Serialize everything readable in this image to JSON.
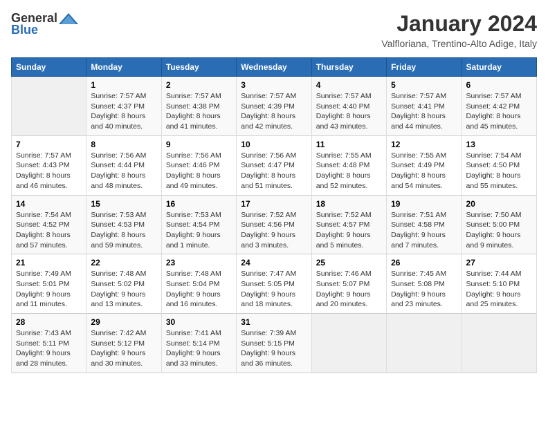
{
  "header": {
    "logo_general": "General",
    "logo_blue": "Blue",
    "month_year": "January 2024",
    "location": "Valfloriana, Trentino-Alto Adige, Italy"
  },
  "days_of_week": [
    "Sunday",
    "Monday",
    "Tuesday",
    "Wednesday",
    "Thursday",
    "Friday",
    "Saturday"
  ],
  "weeks": [
    [
      {
        "day": "",
        "content": ""
      },
      {
        "day": "1",
        "content": "Sunrise: 7:57 AM\nSunset: 4:37 PM\nDaylight: 8 hours\nand 40 minutes."
      },
      {
        "day": "2",
        "content": "Sunrise: 7:57 AM\nSunset: 4:38 PM\nDaylight: 8 hours\nand 41 minutes."
      },
      {
        "day": "3",
        "content": "Sunrise: 7:57 AM\nSunset: 4:39 PM\nDaylight: 8 hours\nand 42 minutes."
      },
      {
        "day": "4",
        "content": "Sunrise: 7:57 AM\nSunset: 4:40 PM\nDaylight: 8 hours\nand 43 minutes."
      },
      {
        "day": "5",
        "content": "Sunrise: 7:57 AM\nSunset: 4:41 PM\nDaylight: 8 hours\nand 44 minutes."
      },
      {
        "day": "6",
        "content": "Sunrise: 7:57 AM\nSunset: 4:42 PM\nDaylight: 8 hours\nand 45 minutes."
      }
    ],
    [
      {
        "day": "7",
        "content": "Sunrise: 7:57 AM\nSunset: 4:43 PM\nDaylight: 8 hours\nand 46 minutes."
      },
      {
        "day": "8",
        "content": "Sunrise: 7:56 AM\nSunset: 4:44 PM\nDaylight: 8 hours\nand 48 minutes."
      },
      {
        "day": "9",
        "content": "Sunrise: 7:56 AM\nSunset: 4:46 PM\nDaylight: 8 hours\nand 49 minutes."
      },
      {
        "day": "10",
        "content": "Sunrise: 7:56 AM\nSunset: 4:47 PM\nDaylight: 8 hours\nand 51 minutes."
      },
      {
        "day": "11",
        "content": "Sunrise: 7:55 AM\nSunset: 4:48 PM\nDaylight: 8 hours\nand 52 minutes."
      },
      {
        "day": "12",
        "content": "Sunrise: 7:55 AM\nSunset: 4:49 PM\nDaylight: 8 hours\nand 54 minutes."
      },
      {
        "day": "13",
        "content": "Sunrise: 7:54 AM\nSunset: 4:50 PM\nDaylight: 8 hours\nand 55 minutes."
      }
    ],
    [
      {
        "day": "14",
        "content": "Sunrise: 7:54 AM\nSunset: 4:52 PM\nDaylight: 8 hours\nand 57 minutes."
      },
      {
        "day": "15",
        "content": "Sunrise: 7:53 AM\nSunset: 4:53 PM\nDaylight: 8 hours\nand 59 minutes."
      },
      {
        "day": "16",
        "content": "Sunrise: 7:53 AM\nSunset: 4:54 PM\nDaylight: 9 hours\nand 1 minute."
      },
      {
        "day": "17",
        "content": "Sunrise: 7:52 AM\nSunset: 4:56 PM\nDaylight: 9 hours\nand 3 minutes."
      },
      {
        "day": "18",
        "content": "Sunrise: 7:52 AM\nSunset: 4:57 PM\nDaylight: 9 hours\nand 5 minutes."
      },
      {
        "day": "19",
        "content": "Sunrise: 7:51 AM\nSunset: 4:58 PM\nDaylight: 9 hours\nand 7 minutes."
      },
      {
        "day": "20",
        "content": "Sunrise: 7:50 AM\nSunset: 5:00 PM\nDaylight: 9 hours\nand 9 minutes."
      }
    ],
    [
      {
        "day": "21",
        "content": "Sunrise: 7:49 AM\nSunset: 5:01 PM\nDaylight: 9 hours\nand 11 minutes."
      },
      {
        "day": "22",
        "content": "Sunrise: 7:48 AM\nSunset: 5:02 PM\nDaylight: 9 hours\nand 13 minutes."
      },
      {
        "day": "23",
        "content": "Sunrise: 7:48 AM\nSunset: 5:04 PM\nDaylight: 9 hours\nand 16 minutes."
      },
      {
        "day": "24",
        "content": "Sunrise: 7:47 AM\nSunset: 5:05 PM\nDaylight: 9 hours\nand 18 minutes."
      },
      {
        "day": "25",
        "content": "Sunrise: 7:46 AM\nSunset: 5:07 PM\nDaylight: 9 hours\nand 20 minutes."
      },
      {
        "day": "26",
        "content": "Sunrise: 7:45 AM\nSunset: 5:08 PM\nDaylight: 9 hours\nand 23 minutes."
      },
      {
        "day": "27",
        "content": "Sunrise: 7:44 AM\nSunset: 5:10 PM\nDaylight: 9 hours\nand 25 minutes."
      }
    ],
    [
      {
        "day": "28",
        "content": "Sunrise: 7:43 AM\nSunset: 5:11 PM\nDaylight: 9 hours\nand 28 minutes."
      },
      {
        "day": "29",
        "content": "Sunrise: 7:42 AM\nSunset: 5:12 PM\nDaylight: 9 hours\nand 30 minutes."
      },
      {
        "day": "30",
        "content": "Sunrise: 7:41 AM\nSunset: 5:14 PM\nDaylight: 9 hours\nand 33 minutes."
      },
      {
        "day": "31",
        "content": "Sunrise: 7:39 AM\nSunset: 5:15 PM\nDaylight: 9 hours\nand 36 minutes."
      },
      {
        "day": "",
        "content": ""
      },
      {
        "day": "",
        "content": ""
      },
      {
        "day": "",
        "content": ""
      }
    ]
  ]
}
